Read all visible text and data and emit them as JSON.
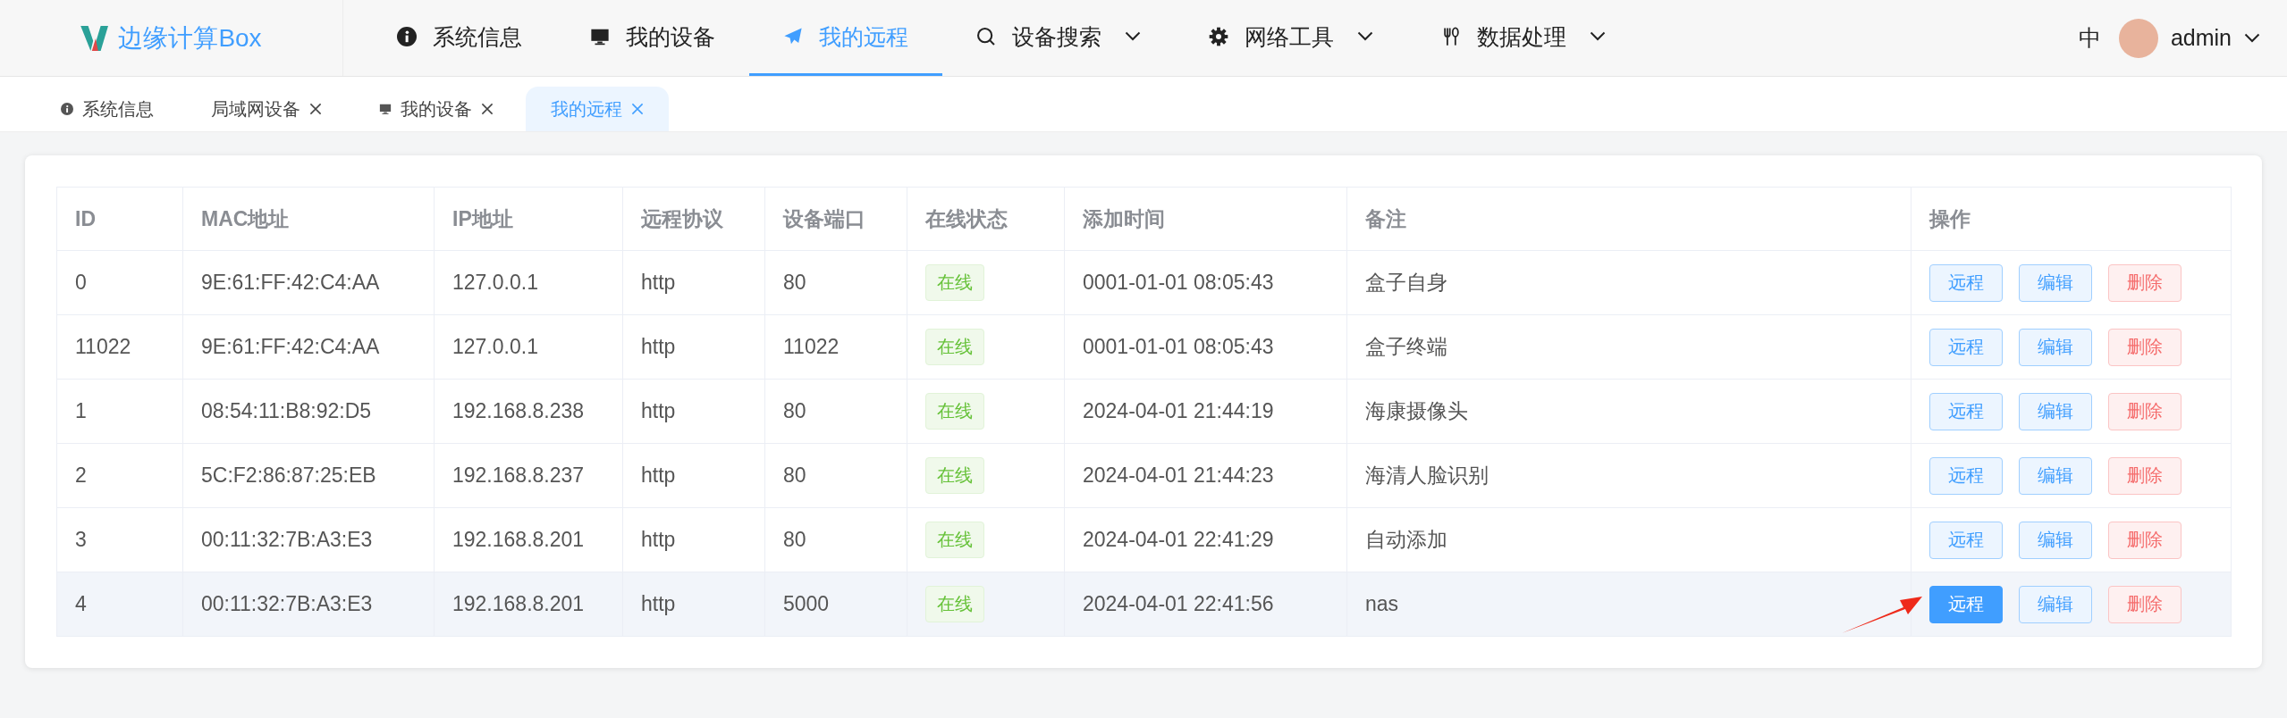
{
  "logo": {
    "text": "边缘计算Box"
  },
  "nav": [
    {
      "label": "系统信息",
      "kind": "info",
      "selected": false,
      "dropdown": false
    },
    {
      "label": "我的设备",
      "kind": "monitor",
      "selected": false,
      "dropdown": false
    },
    {
      "label": "我的远程",
      "kind": "send",
      "selected": true,
      "dropdown": false
    },
    {
      "label": "设备搜索",
      "kind": "search",
      "selected": false,
      "dropdown": true
    },
    {
      "label": "网络工具",
      "kind": "gear",
      "selected": false,
      "dropdown": true
    },
    {
      "label": "数据处理",
      "kind": "fork",
      "selected": false,
      "dropdown": true
    }
  ],
  "language": "中",
  "user": {
    "name": "admin"
  },
  "tabs": [
    {
      "label": "系统信息",
      "kind": "info",
      "closable": false,
      "selected": false
    },
    {
      "label": "局域网设备",
      "kind": "plain",
      "closable": true,
      "selected": false
    },
    {
      "label": "我的设备",
      "kind": "monitor",
      "closable": true,
      "selected": false
    },
    {
      "label": "我的远程",
      "kind": "plain",
      "closable": true,
      "selected": true
    }
  ],
  "table": {
    "columns": [
      "ID",
      "MAC地址",
      "IP地址",
      "远程协议",
      "设备端口",
      "在线状态",
      "添加时间",
      "备注",
      "操作"
    ],
    "rows": [
      {
        "id": "0",
        "mac": "9E:61:FF:42:C4:AA",
        "ip": "127.0.0.1",
        "protocol": "http",
        "port": "80",
        "status": "在线",
        "added": "0001-01-01 08:05:43",
        "note": "盒子自身",
        "highlighted": false,
        "actions": [
          {
            "label": "远程",
            "kind": "primary",
            "active": false
          },
          {
            "label": "编辑",
            "kind": "primary",
            "active": false
          },
          {
            "label": "删除",
            "kind": "danger",
            "active": false
          }
        ]
      },
      {
        "id": "11022",
        "mac": "9E:61:FF:42:C4:AA",
        "ip": "127.0.0.1",
        "protocol": "http",
        "port": "11022",
        "status": "在线",
        "added": "0001-01-01 08:05:43",
        "note": "盒子终端",
        "highlighted": false,
        "actions": [
          {
            "label": "远程",
            "kind": "primary",
            "active": false
          },
          {
            "label": "编辑",
            "kind": "primary",
            "active": false
          },
          {
            "label": "删除",
            "kind": "danger",
            "active": false
          }
        ]
      },
      {
        "id": "1",
        "mac": "08:54:11:B8:92:D5",
        "ip": "192.168.8.238",
        "protocol": "http",
        "port": "80",
        "status": "在线",
        "added": "2024-04-01 21:44:19",
        "note": "海康摄像头",
        "highlighted": false,
        "actions": [
          {
            "label": "远程",
            "kind": "primary",
            "active": false
          },
          {
            "label": "编辑",
            "kind": "primary",
            "active": false
          },
          {
            "label": "删除",
            "kind": "danger",
            "active": false
          }
        ]
      },
      {
        "id": "2",
        "mac": "5C:F2:86:87:25:EB",
        "ip": "192.168.8.237",
        "protocol": "http",
        "port": "80",
        "status": "在线",
        "added": "2024-04-01 21:44:23",
        "note": "海清人脸识别",
        "highlighted": false,
        "actions": [
          {
            "label": "远程",
            "kind": "primary",
            "active": false
          },
          {
            "label": "编辑",
            "kind": "primary",
            "active": false
          },
          {
            "label": "删除",
            "kind": "danger",
            "active": false
          }
        ]
      },
      {
        "id": "3",
        "mac": "00:11:32:7B:A3:E3",
        "ip": "192.168.8.201",
        "protocol": "http",
        "port": "80",
        "status": "在线",
        "added": "2024-04-01 22:41:29",
        "note": "自动添加",
        "highlighted": false,
        "actions": [
          {
            "label": "远程",
            "kind": "primary",
            "active": false
          },
          {
            "label": "编辑",
            "kind": "primary",
            "active": false
          },
          {
            "label": "删除",
            "kind": "danger",
            "active": false
          }
        ]
      },
      {
        "id": "4",
        "mac": "00:11:32:7B:A3:E3",
        "ip": "192.168.8.201",
        "protocol": "http",
        "port": "5000",
        "status": "在线",
        "added": "2024-04-01 22:41:56",
        "note": "nas",
        "highlighted": true,
        "actions": [
          {
            "label": "远程",
            "kind": "primary",
            "active": true
          },
          {
            "label": "编辑",
            "kind": "primary",
            "active": false
          },
          {
            "label": "删除",
            "kind": "danger",
            "active": false
          }
        ]
      }
    ]
  }
}
